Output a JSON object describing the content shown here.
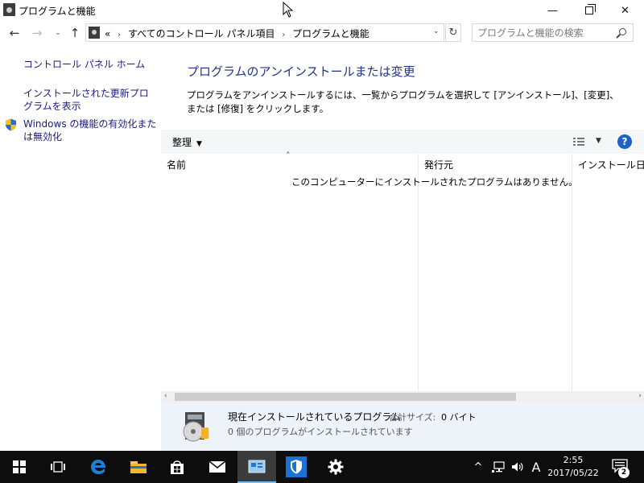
{
  "window": {
    "title": "プログラムと機能",
    "minimize_glyph": "—",
    "close_glyph": "✕"
  },
  "navigation": {
    "back_glyph": "←",
    "forward_glyph": "→",
    "history_glyph": "⌄",
    "up_glyph": "↑",
    "overflow_glyph": "«",
    "breadcrumbs": [
      "すべてのコントロール パネル項目",
      "プログラムと機能"
    ],
    "separator_glyph": "›",
    "dropdown_glyph": "⌄",
    "refresh_glyph": "↻",
    "search_placeholder": "プログラムと機能の検索"
  },
  "sidebar": {
    "items": [
      {
        "label": "コントロール パネル ホーム"
      },
      {
        "label": "インストールされた更新プログラムを表示"
      },
      {
        "label": "Windows の機能の有効化または無効化",
        "icon": "uac-shield-icon"
      }
    ]
  },
  "main": {
    "title": "プログラムのアンインストールまたは変更",
    "description": "プログラムをアンインストールするには、一覧からプログラムを選択して [アンインストール]、[変更]、または [修復] をクリックします。"
  },
  "toolbar": {
    "organize_label": "整理",
    "caret": "▼",
    "view_caret": "▼",
    "help_label": "?"
  },
  "table": {
    "columns": [
      "名前",
      "発行元",
      "インストール日"
    ],
    "sort_indicator": "⌃",
    "empty_message": "このコンピューターにインストールされたプログラムはありません。",
    "rows": []
  },
  "scrollbar": {
    "left_glyph": "‹",
    "right_glyph": "›"
  },
  "details": {
    "title": "現在インストールされているプログラム",
    "total_size_label": "合計サイズ:",
    "total_size_value": "0 バイト",
    "count_text": "0 個のプログラムがインストールされています"
  },
  "taskbar": {
    "apps": [
      "start-icon",
      "task-view-icon",
      "edge-icon",
      "file-explorer-icon",
      "store-icon",
      "mail-icon",
      "control-panel-icon",
      "defender-icon",
      "settings-icon"
    ],
    "active_app": "control-panel-icon",
    "tray": {
      "chevron_glyph": "^",
      "input_indicator": "A",
      "time": "2:55",
      "date": "2017/05/22",
      "notification_count": "2"
    }
  },
  "colors": {
    "accent": "#1e62c8",
    "title_blue": "#1e3287",
    "link": "#1a1a80",
    "taskbar": "#0d0d0d",
    "details_bg": "#eef3fa"
  }
}
